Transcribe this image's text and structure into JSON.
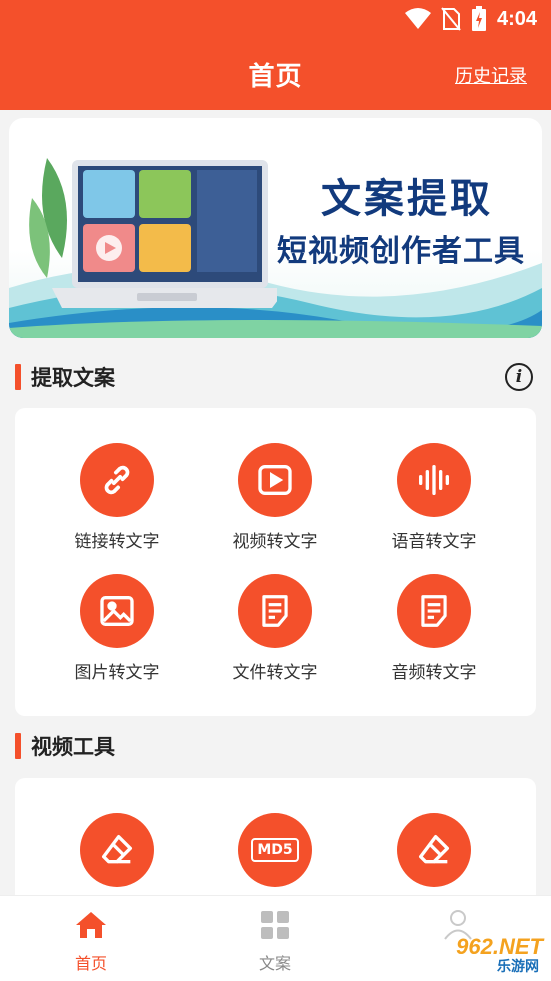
{
  "status_bar": {
    "time": "4:04",
    "icons": [
      "wifi-icon",
      "no-sim-icon",
      "battery-charging-icon"
    ]
  },
  "header": {
    "title": "首页",
    "history_link": "历史记录"
  },
  "banner": {
    "title": "文案提取",
    "subtitle": "短视频创作者工具"
  },
  "sections": {
    "extract": {
      "title": "提取文案",
      "info_icon": "info-icon",
      "tools": [
        {
          "label": "链接转文字",
          "icon": "link-icon"
        },
        {
          "label": "视频转文字",
          "icon": "play-icon"
        },
        {
          "label": "语音转文字",
          "icon": "waveform-icon"
        },
        {
          "label": "图片转文字",
          "icon": "image-icon"
        },
        {
          "label": "文件转文字",
          "icon": "document-icon"
        },
        {
          "label": "音频转文字",
          "icon": "document-icon"
        }
      ]
    },
    "video": {
      "title": "视频工具",
      "tools": [
        {
          "icon": "eraser-icon"
        },
        {
          "icon": "md5-icon",
          "icon_text": "MD5"
        },
        {
          "icon": "eraser-icon"
        }
      ]
    }
  },
  "bottom_nav": {
    "items": [
      {
        "label": "首页",
        "icon": "home-icon",
        "active": true
      },
      {
        "label": "文案",
        "icon": "grid-icon",
        "active": false
      },
      {
        "label": "",
        "icon": "profile-icon",
        "active": false
      }
    ]
  },
  "watermark": {
    "text": "962.NET",
    "sub": "乐游网"
  },
  "colors": {
    "accent": "#f4502b",
    "banner_text": "#123a7d",
    "background": "#f3f3f3"
  }
}
